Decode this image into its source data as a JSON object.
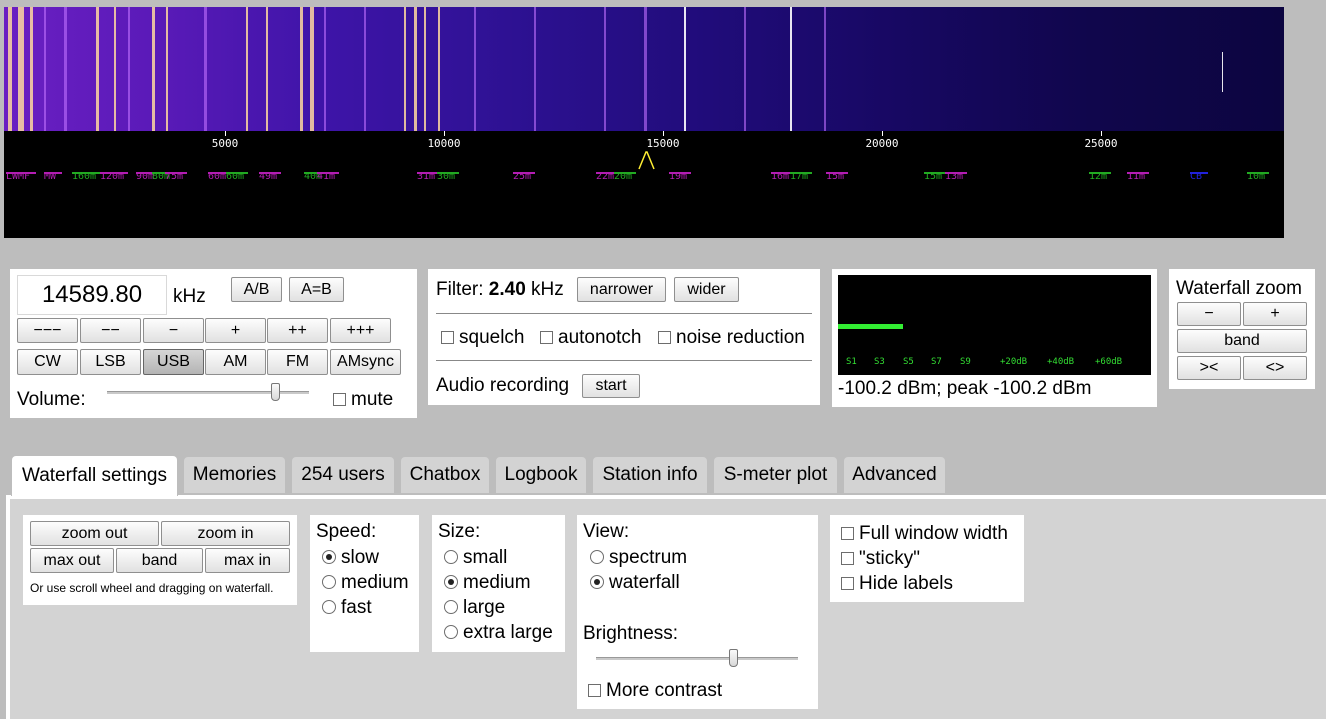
{
  "scale": {
    "ticks": [
      "5000",
      "10000",
      "15000",
      "20000",
      "25000"
    ]
  },
  "bands": [
    {
      "label": "LW",
      "color": "#b31db3"
    },
    {
      "label": "MF",
      "color": "#b31db3"
    },
    {
      "label": "MW",
      "color": "#b31db3"
    },
    {
      "label": "160m",
      "color": "#22aa22"
    },
    {
      "label": "120m",
      "color": "#b31db3"
    },
    {
      "label": "90m",
      "color": "#b31db3"
    },
    {
      "label": "80m",
      "color": "#22aa22"
    },
    {
      "label": "75m",
      "color": "#b31db3"
    },
    {
      "label": "60m",
      "color": "#b31db3"
    },
    {
      "label": "60m",
      "color": "#22aa22"
    },
    {
      "label": "49m",
      "color": "#b31db3"
    },
    {
      "label": "40m",
      "color": "#22aa22"
    },
    {
      "label": "41m",
      "color": "#b31db3"
    },
    {
      "label": "31m",
      "color": "#b31db3"
    },
    {
      "label": "30m",
      "color": "#22aa22"
    },
    {
      "label": "25m",
      "color": "#b31db3"
    },
    {
      "label": "22m",
      "color": "#b31db3"
    },
    {
      "label": "20m",
      "color": "#22aa22"
    },
    {
      "label": "19m",
      "color": "#b31db3"
    },
    {
      "label": "16m",
      "color": "#b31db3"
    },
    {
      "label": "17m",
      "color": "#22aa22"
    },
    {
      "label": "15m",
      "color": "#b31db3"
    },
    {
      "label": "15m",
      "color": "#22aa22"
    },
    {
      "label": "13m",
      "color": "#b31db3"
    },
    {
      "label": "12m",
      "color": "#22aa22"
    },
    {
      "label": "11m",
      "color": "#b31db3"
    },
    {
      "label": "CB",
      "color": "#2222dd"
    },
    {
      "label": "10m",
      "color": "#22aa22"
    }
  ],
  "tuning": {
    "frequency": "14589.80",
    "unit": "kHz",
    "ab_label": "A/B",
    "aeqb_label": "A=B",
    "step_buttons": [
      "−−−",
      "−−",
      "−",
      "+",
      "++",
      "+++"
    ],
    "modes": [
      "CW",
      "LSB",
      "USB",
      "AM",
      "FM",
      "AMsync"
    ],
    "selected_mode": "USB",
    "volume_label": "Volume:",
    "volume_level": 0.83,
    "mute_label": "mute"
  },
  "filter": {
    "label": "Filter:",
    "value": "2.40",
    "unit": "kHz",
    "narrower_label": "narrower",
    "wider_label": "wider",
    "squelch_label": "squelch",
    "autonotch_label": "autonotch",
    "noise_reduction_label": "noise reduction",
    "recording_label": "Audio recording",
    "start_label": "start"
  },
  "smeter": {
    "scale": [
      "S1",
      "S3",
      "S5",
      "S7",
      "S9",
      "+20dB",
      "+40dB",
      "+60dB"
    ],
    "bar_color": "#33ee33",
    "reading": "-100.2 dBm; peak -100.2 dBm"
  },
  "waterfall_zoom": {
    "title": "Waterfall zoom",
    "minus": "−",
    "plus": "+",
    "band": "band",
    "left": "><",
    "right": "<>"
  },
  "tabs": [
    "Waterfall settings",
    "Memories",
    "254 users",
    "Chatbox",
    "Logbook",
    "Station info",
    "S-meter plot",
    "Advanced"
  ],
  "active_tab": "Waterfall settings",
  "settings": {
    "zoom_out": "zoom out",
    "zoom_in": "zoom in",
    "max_out": "max out",
    "band": "band",
    "max_in": "max in",
    "hint": "Or use scroll wheel and dragging on waterfall.",
    "speed_title": "Speed:",
    "speed_options": [
      "slow",
      "medium",
      "fast"
    ],
    "speed_selected": "slow",
    "size_title": "Size:",
    "size_options": [
      "small",
      "medium",
      "large",
      "extra large"
    ],
    "size_selected": "medium",
    "view_title": "View:",
    "view_options": [
      "spectrum",
      "waterfall"
    ],
    "view_selected": "waterfall",
    "brightness_title": "Brightness:",
    "brightness_level": 0.68,
    "more_contrast": "More contrast",
    "full_width": "Full window width",
    "sticky": "\"sticky\"",
    "hide_labels": "Hide labels"
  }
}
